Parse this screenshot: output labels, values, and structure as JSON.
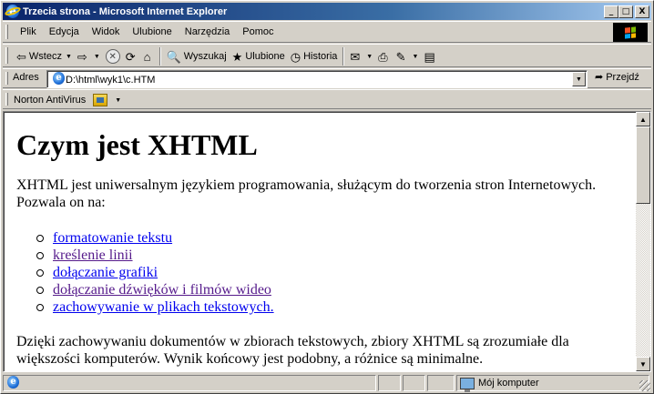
{
  "window": {
    "title": "Trzecia strona - Microsoft Internet Explorer",
    "minimize_label": "_",
    "maximize_label": "□",
    "close_label": "X"
  },
  "menu": {
    "items": [
      "Plik",
      "Edycja",
      "Widok",
      "Ulubione",
      "Narzędzia",
      "Pomoc"
    ]
  },
  "toolbar": {
    "back_label": "Wstecz",
    "search_label": "Wyszukaj",
    "favorites_label": "Ulubione",
    "history_label": "Historia"
  },
  "address": {
    "label": "Adres",
    "value": "D:\\html\\wyk1\\c.HTM",
    "go_label": "Przejdź"
  },
  "norton": {
    "label": "Norton AntiVirus"
  },
  "page": {
    "heading": "Czym jest XHTML",
    "intro": "XHTML jest uniwersalnym językiem programowania, służącym do tworzenia stron Internetowych.",
    "intro2": "Pozwala on na:",
    "links": [
      {
        "label": "formatowanie tekstu",
        "visited": false
      },
      {
        "label": "kreślenie linii",
        "visited": true
      },
      {
        "label": "dołączanie grafiki",
        "visited": false
      },
      {
        "label": "dołączanie dźwięków i filmów wideo",
        "visited": true
      },
      {
        "label": "zachowywanie w plikach tekstowych.",
        "visited": false
      }
    ],
    "outro": "Dzięki zachowywaniu dokumentów w zbiorach tekstowych, zbiory XHTML są zrozumiałe dla większości komputerów. Wynik końcowy jest podobny, a różnice są minimalne."
  },
  "status": {
    "zone_label": "Mój komputer"
  },
  "colors": {
    "titlebar_start": "#0a246a",
    "titlebar_end": "#a6caf0",
    "link": "#0000ee",
    "visited_link": "#551a8b",
    "chrome": "#d4d0c8"
  }
}
